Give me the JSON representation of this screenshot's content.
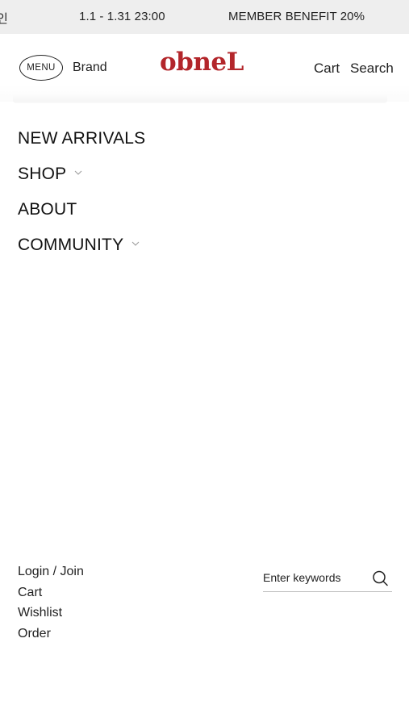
{
  "topbar": {
    "items": [
      {
        "text": "인"
      },
      {
        "text": "1.1 - 1.31 23:00"
      },
      {
        "text": "MEMBER BENEFIT 20%"
      }
    ]
  },
  "header": {
    "menu_label": "MENU",
    "brand_label": "Brand",
    "logo_text": "obneL",
    "cart_label": "Cart",
    "search_label": "Search"
  },
  "nav": {
    "items": [
      {
        "label": "NEW ARRIVALS",
        "has_dropdown": false
      },
      {
        "label": "SHOP",
        "has_dropdown": true
      },
      {
        "label": "ABOUT",
        "has_dropdown": false
      },
      {
        "label": "COMMUNITY",
        "has_dropdown": true
      }
    ]
  },
  "footer": {
    "links": [
      {
        "label": "Login / Join"
      },
      {
        "label": "Cart"
      },
      {
        "label": "Wishlist"
      },
      {
        "label": "Order"
      }
    ],
    "search": {
      "placeholder": "Enter keywords",
      "value": "",
      "icon": "search-icon"
    }
  },
  "colors": {
    "topbar_bg": "#eeeeee",
    "logo": "#b3262b",
    "text": "#111111"
  }
}
